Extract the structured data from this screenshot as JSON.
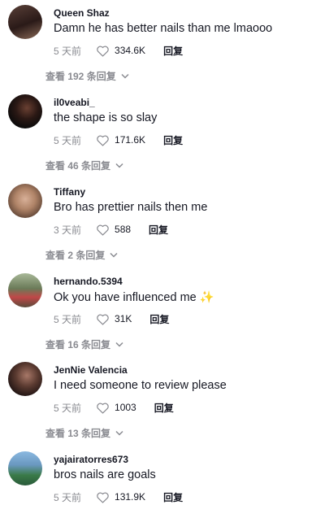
{
  "comments": [
    {
      "user": "Queen Shaz",
      "text": "Damn he has better nails than me lmaooo",
      "time": "5 天前",
      "likes": "334.6K",
      "reply": "回复",
      "view_replies": "查看 192 条回复",
      "avatar_colors": [
        "#3a2a2a",
        "#7a5a4a"
      ]
    },
    {
      "user": "il0veabi_",
      "text": "the shape is so slay",
      "time": "5 天前",
      "likes": "171.6K",
      "reply": "回复",
      "view_replies": "查看 46 条回复",
      "avatar_colors": [
        "#111111",
        "#4a3028"
      ]
    },
    {
      "user": "Tiffany",
      "text": "Bro has prettier nails then me",
      "time": "3 天前",
      "likes": "588",
      "reply": "回复",
      "view_replies": "查看 2 条回复",
      "avatar_colors": [
        "#c89878",
        "#6a5040"
      ]
    },
    {
      "user": "hernando.5394",
      "text": "Ok you have influenced me",
      "emoji": "✨",
      "time": "5 天前",
      "likes": "31K",
      "reply": "回复",
      "view_replies": "查看 16 条回复",
      "avatar_colors": [
        "#7a8a6a",
        "#c04040"
      ]
    },
    {
      "user": "JenNie Valencia",
      "text": "I need someone to review please",
      "time": "5 天前",
      "likes": "1003",
      "reply": "回复",
      "view_replies": "查看 13 条回复",
      "avatar_colors": [
        "#2a1a1a",
        "#9a6a60"
      ]
    },
    {
      "user": "yajairatorres673",
      "text": "bros nails are goals",
      "time": "5 天前",
      "likes": "131.9K",
      "reply": "回复",
      "avatar_colors": [
        "#6a9ac8",
        "#3a6a3a"
      ]
    }
  ]
}
